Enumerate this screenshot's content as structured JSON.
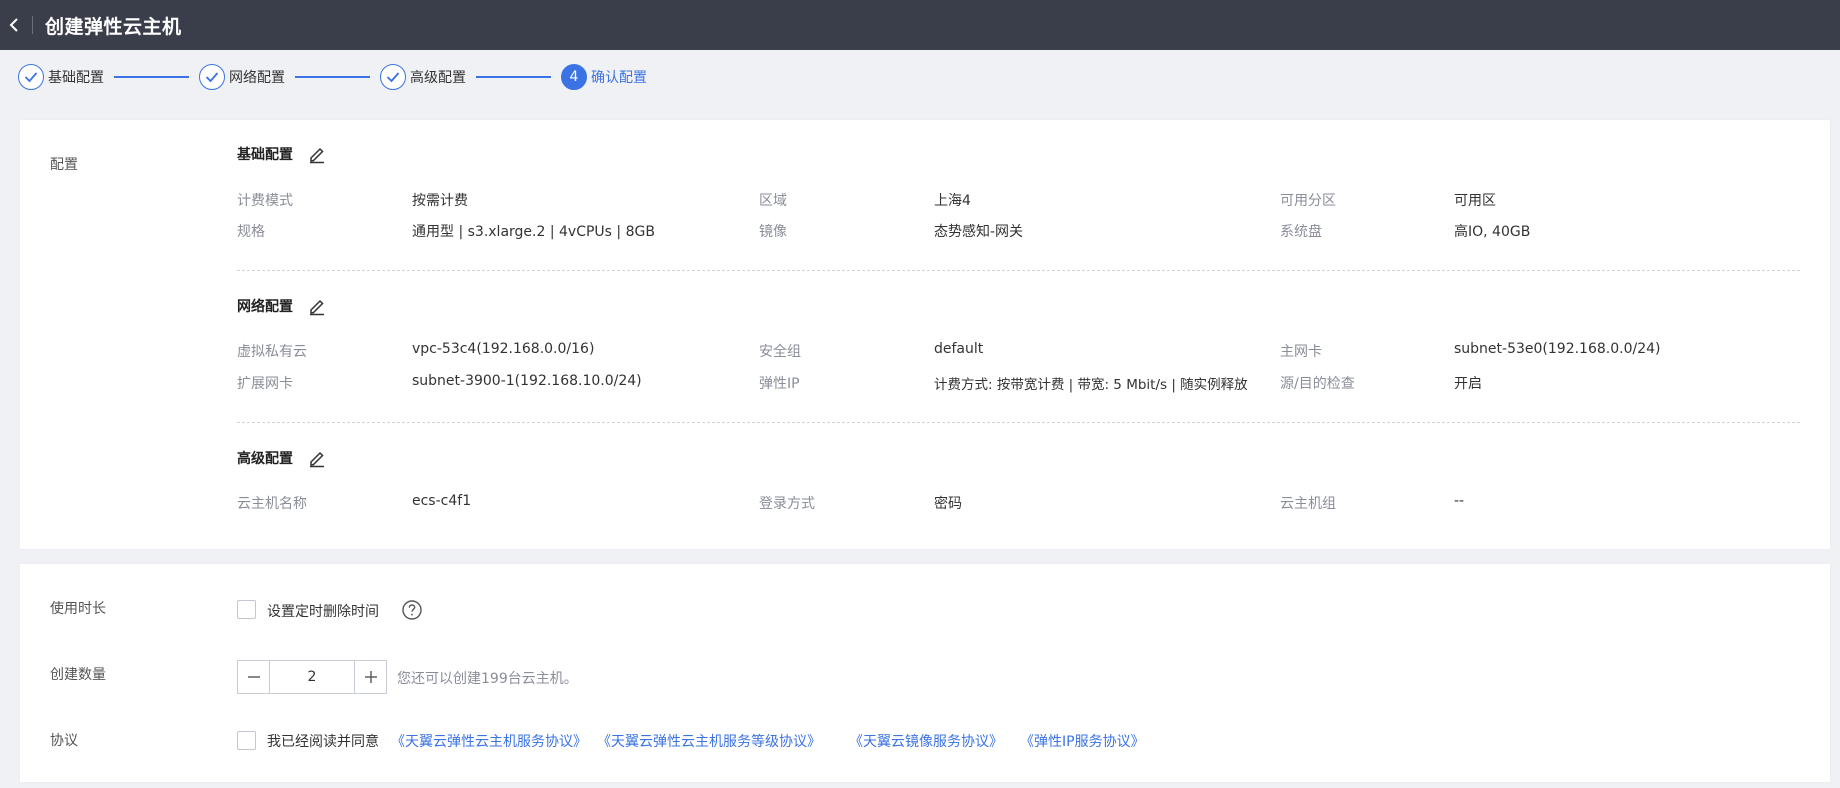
{
  "header": {
    "title": "创建弹性云主机"
  },
  "steps": [
    {
      "label": "基础配置",
      "done": true
    },
    {
      "label": "网络配置",
      "done": true
    },
    {
      "label": "高级配置",
      "done": true
    },
    {
      "label": "确认配置",
      "number": "4",
      "active": true
    }
  ],
  "config": {
    "section_label": "配置",
    "basic": {
      "title": "基础配置",
      "billing_mode_key": "计费模式",
      "billing_mode_val": "按需计费",
      "region_key": "区域",
      "region_val": "上海4",
      "az_key": "可用分区",
      "az_val": "可用区",
      "spec_key": "规格",
      "spec_val": "通用型 | s3.xlarge.2 | 4vCPUs | 8GB",
      "image_key": "镜像",
      "image_val": "态势感知-网关",
      "disk_key": "系统盘",
      "disk_val": "高IO, 40GB"
    },
    "network": {
      "title": "网络配置",
      "vpc_key": "虚拟私有云",
      "vpc_val": "vpc-53c4(192.168.0.0/16)",
      "sg_key": "安全组",
      "sg_val": "default",
      "nic_key": "主网卡",
      "nic_val": "subnet-53e0(192.168.0.0/24)",
      "ext_nic_key": "扩展网卡",
      "ext_nic_val": "subnet-3900-1(192.168.10.0/24)",
      "eip_key": "弹性IP",
      "eip_val": "计费方式: 按带宽计费 | 带宽: 5 Mbit/s | 随实例释放",
      "src_dst_key": "源/目的检查",
      "src_dst_val": "开启"
    },
    "advanced": {
      "title": "高级配置",
      "name_key": "云主机名称",
      "name_val": "ecs-c4f1",
      "login_key": "登录方式",
      "login_val": "密码",
      "group_key": "云主机组",
      "group_val": "--"
    }
  },
  "usage": {
    "duration_label": "使用时长",
    "timed_delete_label": "设置定时删除时间",
    "quantity_label": "创建数量",
    "quantity_value": "2",
    "quantity_hint": "您还可以创建199台云主机。",
    "agreement_label": "协议",
    "agreement_prefix": "我已经阅读并同意",
    "links": [
      "《天翼云弹性云主机服务协议》",
      "《天翼云弹性云主机服务等级协议》",
      "《天翼云镜像服务协议》",
      "《弹性IP服务协议》"
    ]
  },
  "colors": {
    "topbar": "#3a3e4b",
    "accent": "#3b73e4",
    "background": "#f0f1f4"
  }
}
